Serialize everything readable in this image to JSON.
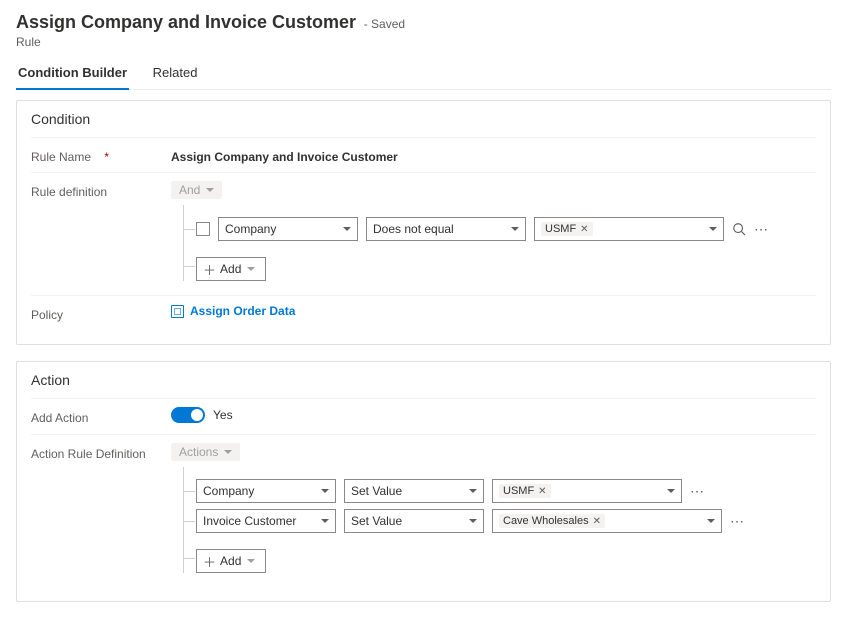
{
  "header": {
    "title": "Assign Company and Invoice Customer",
    "status": "- Saved",
    "subtype": "Rule"
  },
  "tabs": {
    "items": [
      "Condition Builder",
      "Related"
    ],
    "active_index": 0
  },
  "condition": {
    "section_title": "Condition",
    "rule_name_label": "Rule Name",
    "rule_name_value": "Assign Company and Invoice Customer",
    "rule_definition_label": "Rule definition",
    "group_logic": "And",
    "rows": [
      {
        "field": "Company",
        "operator": "Does not equal",
        "value": "USMF"
      }
    ],
    "add_label": "Add",
    "policy_label": "Policy",
    "policy_link": "Assign Order Data"
  },
  "action": {
    "section_title": "Action",
    "add_action_label": "Add Action",
    "add_action_value": "Yes",
    "definition_label": "Action Rule Definition",
    "group_label": "Actions",
    "rows": [
      {
        "field": "Company",
        "operator": "Set Value",
        "value": "USMF"
      },
      {
        "field": "Invoice Customer",
        "operator": "Set Value",
        "value": "Cave Wholesales"
      }
    ],
    "add_label": "Add"
  }
}
